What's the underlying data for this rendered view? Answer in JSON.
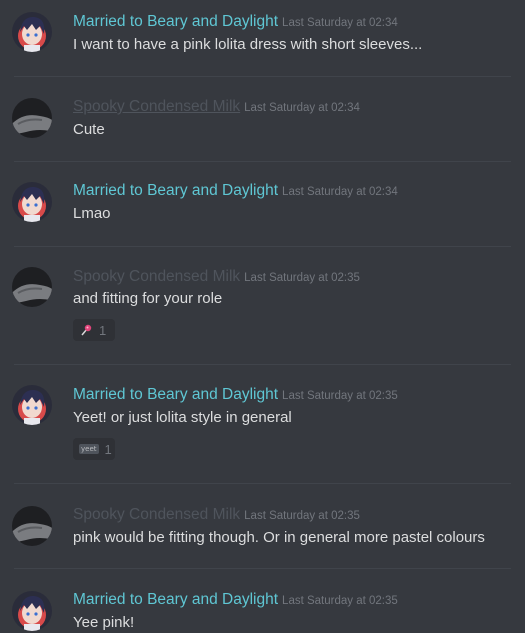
{
  "messages": [
    {
      "author": "Married to Beary and Daylight",
      "timestamp": "Last Saturday at 02:34",
      "text": "I want to have a pink lolita dress with short sleeves..."
    },
    {
      "author": "Spooky Condensed Milk",
      "timestamp": "Last Saturday at 02:34",
      "text": "Cute"
    },
    {
      "author": "Married to Beary and Daylight",
      "timestamp": "Last Saturday at 02:34",
      "text": "Lmao"
    },
    {
      "author": "Spooky Condensed Milk",
      "timestamp": "Last Saturday at 02:35",
      "text": "and fitting for your role",
      "reaction": {
        "emoji": "lollipop-emoji",
        "count": "1"
      }
    },
    {
      "author": "Married to Beary and Daylight",
      "timestamp": "Last Saturday at 02:35",
      "text": "Yeet! or just lolita style in general",
      "reaction": {
        "emoji": "yeet-emoji",
        "label": "yeet",
        "count": "1"
      }
    },
    {
      "author": "Spooky Condensed Milk",
      "timestamp": "Last Saturday at 02:35",
      "text": "pink would be fitting though. Or in general more pastel colours"
    },
    {
      "author": "Married to Beary and Daylight",
      "timestamp": "Last Saturday at 02:35",
      "text": "Yee pink!"
    }
  ],
  "colors": {
    "background": "#36393f",
    "author_teal": "#5fc7d4",
    "author_dim": "#4f545c",
    "text": "#dcddde",
    "timestamp": "#72767d"
  }
}
